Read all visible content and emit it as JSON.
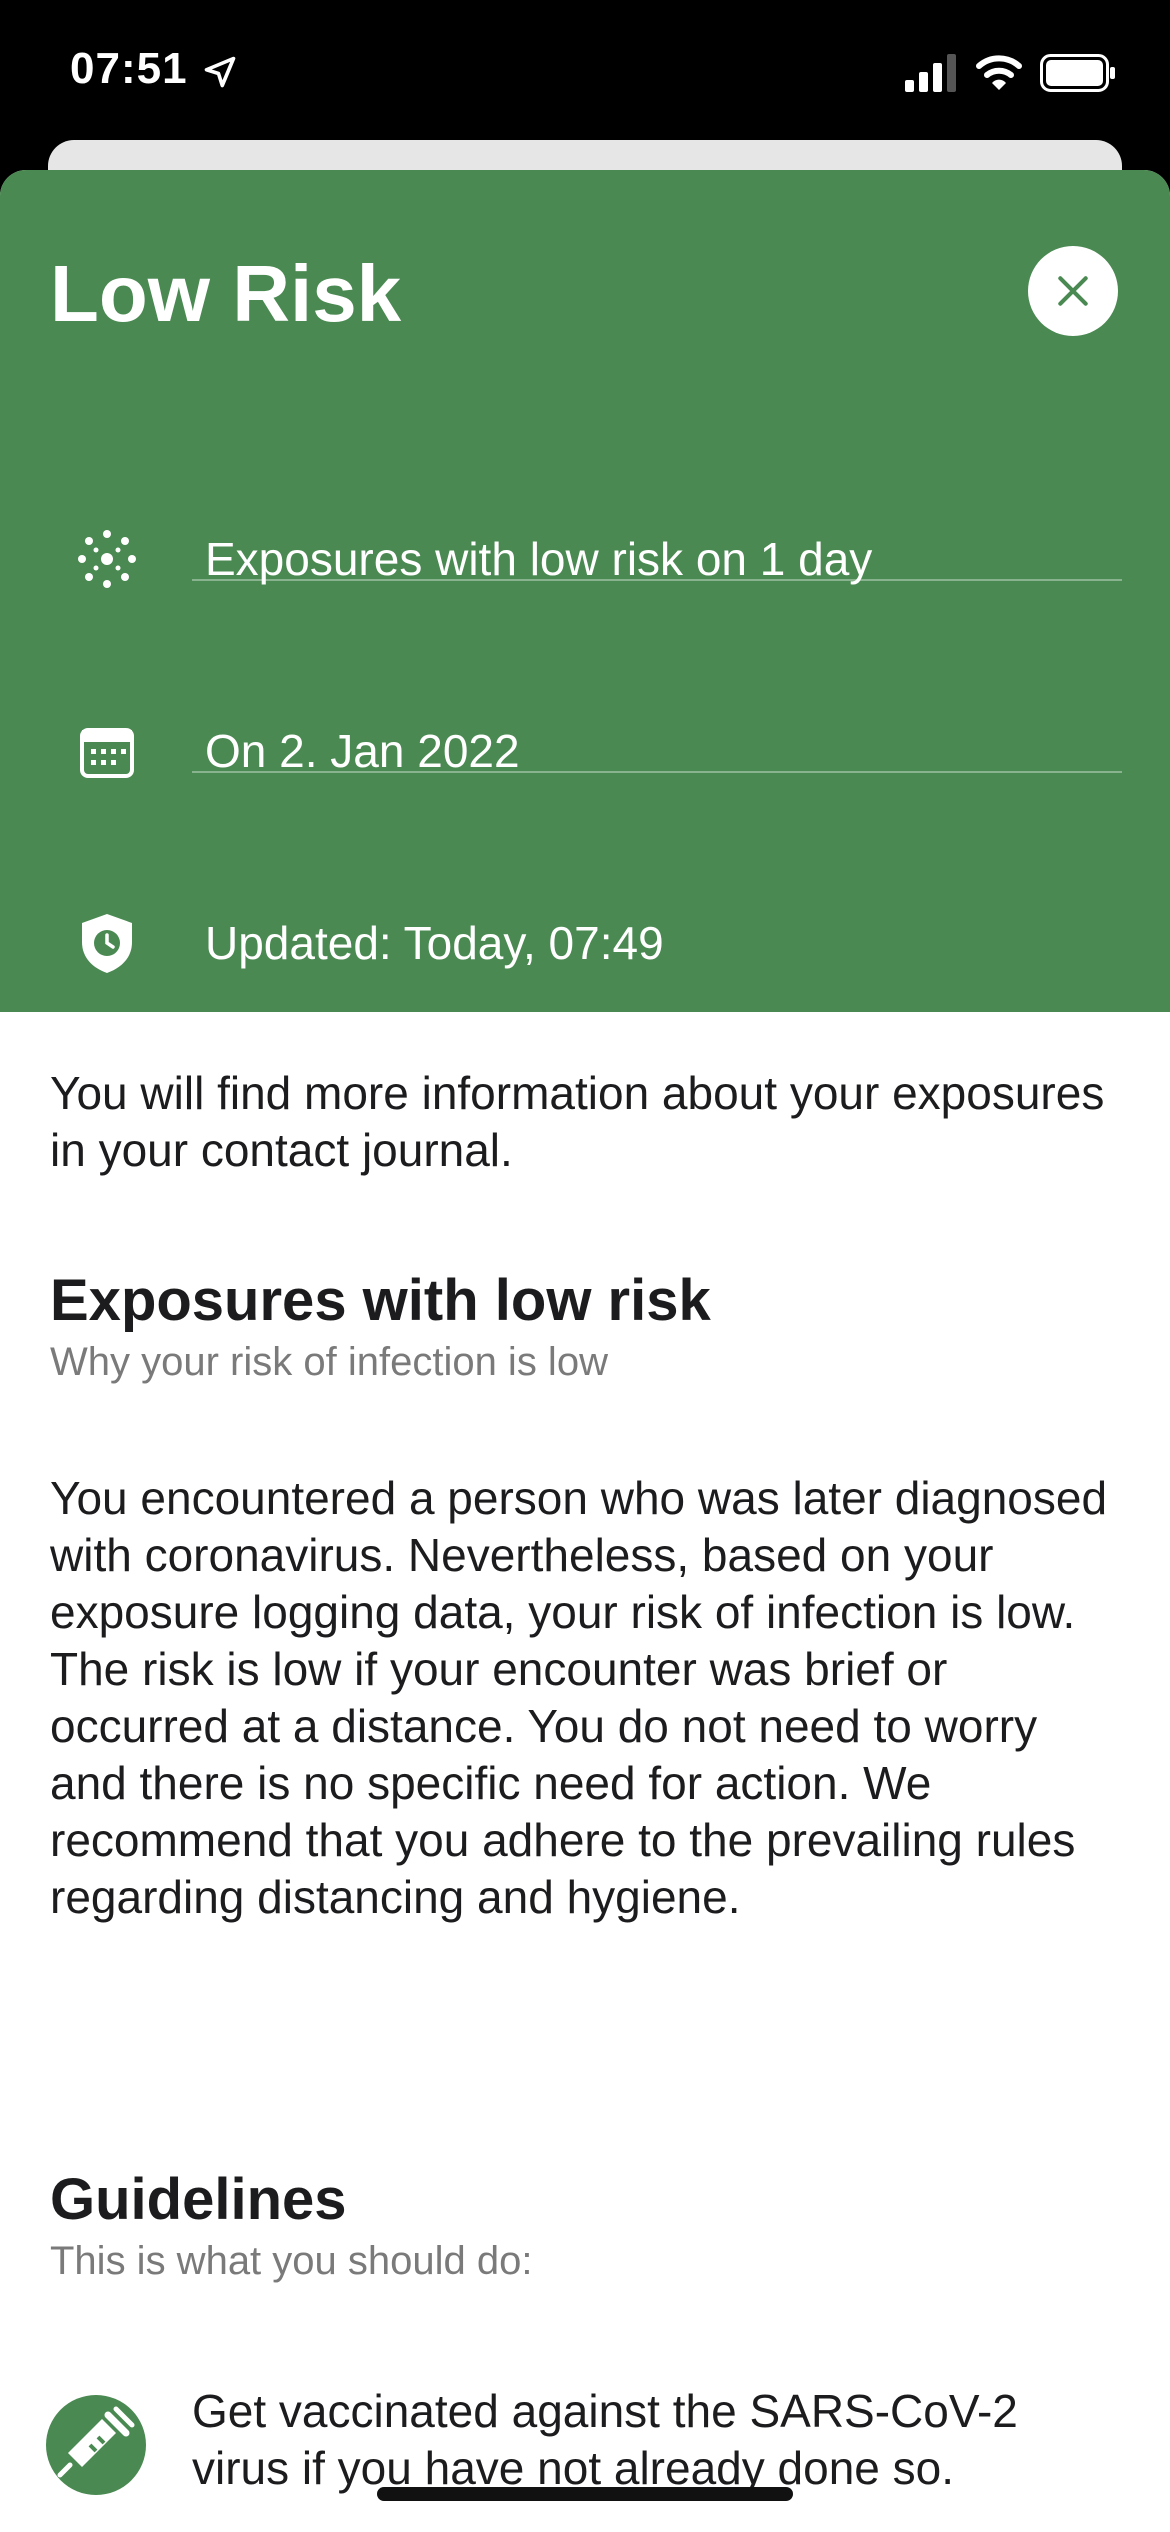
{
  "status_bar": {
    "time": "07:51"
  },
  "header": {
    "title": "Low Risk",
    "rows": [
      {
        "label": "Exposures with low risk on 1 day",
        "icon": "virus-icon"
      },
      {
        "label": "On 2. Jan 2022",
        "icon": "calendar-icon"
      },
      {
        "label": "Updated: Today, 07:49",
        "icon": "shield-clock-icon"
      }
    ]
  },
  "intro": "You will find more information about your exposures in your contact journal.",
  "section_exposures": {
    "title": "Exposures with low risk",
    "subtitle": "Why your risk of infection is low",
    "body": "You encountered a person who was later diagnosed with coronavirus. Nevertheless, based on your exposure logging data, your risk of infection is low. The risk is low if your encounter was brief or occurred at a distance. You do not need to worry and there is no specific need for action. We recommend that you adhere to the prevailing rules regarding distancing and hygiene."
  },
  "section_guidelines": {
    "title": "Guidelines",
    "subtitle": "This is what you should do:",
    "items": [
      {
        "text": "Get vaccinated against the SARS-CoV-2 virus if you have not already done so.",
        "icon": "vaccine-icon"
      }
    ]
  },
  "colors": {
    "header_green": "#4a8a52",
    "text_dark": "#1c1c1e",
    "text_gray": "#7a7a7a"
  }
}
